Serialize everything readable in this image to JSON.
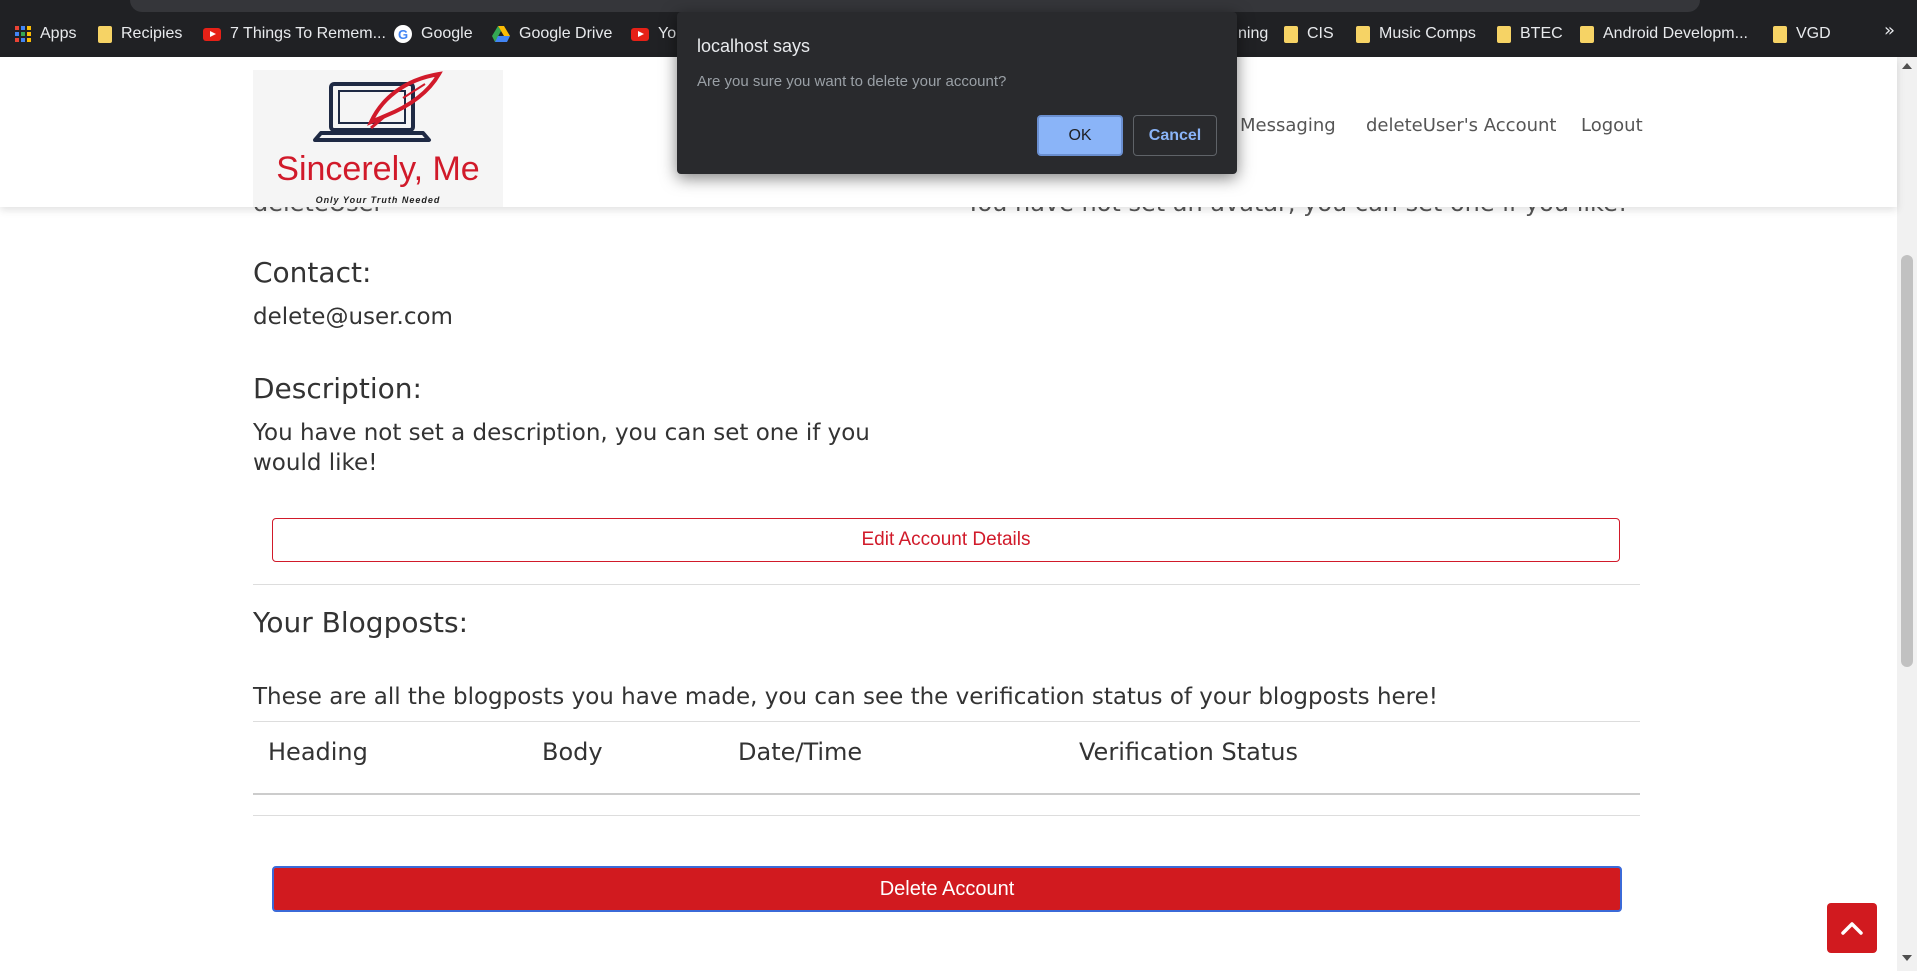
{
  "bookmarks": [
    {
      "label": "Apps",
      "icon": "apps-grid-icon"
    },
    {
      "label": "Recipies",
      "icon": "folder-icon"
    },
    {
      "label": "7 Things To Remem...",
      "icon": "youtube-icon"
    },
    {
      "label": "Google",
      "icon": "google-icon"
    },
    {
      "label": "Google Drive",
      "icon": "drive-icon"
    },
    {
      "label": "Yo",
      "icon": "youtube-icon"
    },
    {
      "label": "ning",
      "icon": ""
    },
    {
      "label": "CIS",
      "icon": "folder-icon"
    },
    {
      "label": "Music Comps",
      "icon": "folder-icon"
    },
    {
      "label": "BTEC",
      "icon": "folder-icon"
    },
    {
      "label": "Android Developm...",
      "icon": "folder-icon"
    },
    {
      "label": "VGD",
      "icon": "folder-icon"
    }
  ],
  "bookmarks_more": "»",
  "dialog": {
    "title": "localhost says",
    "message": "Are you sure you want to delete your account?",
    "ok": "OK",
    "cancel": "Cancel"
  },
  "header": {
    "logo_title": "Sincerely, Me",
    "logo_tagline": "Only Your Truth Needed",
    "nav": [
      "Messaging",
      "deleteUser's Account",
      "Logout"
    ]
  },
  "partial_text": {
    "left": "deleteUser",
    "right": "You have not set an avatar, you can set one if you like!"
  },
  "profile": {
    "contact_label": "Contact:",
    "contact_value": "delete@user.com",
    "description_label": "Description:",
    "description_value": "You have not set a description, you can set one if you would like!",
    "edit_button": "Edit Account Details"
  },
  "blogposts": {
    "heading": "Your Blogposts:",
    "intro": "These are all the blogposts you have made, you can see the verification status of your blogposts here!",
    "columns": [
      "Heading",
      "Body",
      "Date/Time",
      "Verification Status"
    ]
  },
  "delete_button": "Delete Account",
  "colors": {
    "brand_red": "#d11a2a",
    "dialog_bg": "#292a2d",
    "dialog_accent": "#8ab4f8"
  }
}
